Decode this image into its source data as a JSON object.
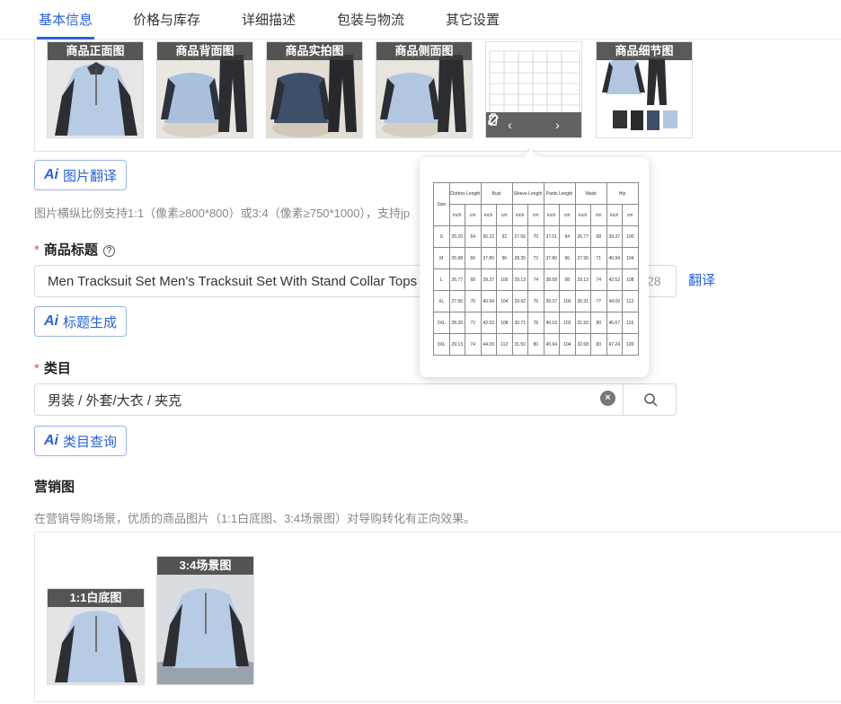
{
  "tabs": [
    "基本信息",
    "价格与库存",
    "详细描述",
    "包装与物流",
    "其它设置"
  ],
  "images": [
    {
      "label": "商品正面图",
      "style": "front"
    },
    {
      "label": "商品背面图",
      "style": "back"
    },
    {
      "label": "商品实拍图",
      "style": "real"
    },
    {
      "label": "商品侧面图",
      "style": "side"
    },
    {
      "label": "",
      "style": "chart"
    },
    {
      "label": "商品细节图",
      "style": "detail"
    }
  ],
  "image_controls": {
    "prev": "‹",
    "next": "›",
    "edit_icon": "pencil-icon",
    "delete_icon": "trash-icon"
  },
  "image_translate_btn": "图片翻译",
  "image_hint": "图片横纵比例支持1:1（像素≥800*800）或3:4（像素≥750*1000），支持jp",
  "title_label": "商品标题",
  "title_help": "?",
  "title_value": "Men Tracksuit Set Men's Tracksuit Set With Stand Collar Tops",
  "title_count": "28",
  "translate_link": "翻译",
  "title_gen_btn": "标题生成",
  "category_label": "类目",
  "category_value": "男装 / 外套/大衣 / 夹克",
  "category_query_btn": "类目查询",
  "marketing_label": "营销图",
  "marketing_hint": "在营销导购场景，优质的商品图片（1:1白底图、3:4场景图）对导购转化有正向效果。",
  "marketing_images": [
    {
      "label": "1:1白底图"
    },
    {
      "label": "3:4场景图"
    }
  ],
  "colors": {
    "accent": "#2962d9",
    "required": "#e34d3b"
  },
  "size_table": {
    "headers": [
      "Size",
      "Clothes Length",
      "Bust",
      "Sleeve Length",
      "Pants Length",
      "Waist",
      "Hip"
    ],
    "units": [
      "inch",
      "cm"
    ],
    "rows": [
      [
        "S",
        "25.20",
        "64",
        "36.22",
        "92",
        "27.56",
        "70",
        "37.01",
        "94",
        "26.77",
        "68",
        "39.37",
        "100"
      ],
      [
        "M",
        "25.98",
        "66",
        "37.80",
        "96",
        "28.35",
        "72",
        "37.80",
        "96",
        "27.95",
        "71",
        "40.94",
        "104"
      ],
      [
        "L",
        "26.77",
        "68",
        "39.37",
        "100",
        "29.13",
        "74",
        "38.58",
        "98",
        "29.13",
        "74",
        "42.52",
        "108"
      ],
      [
        "XL",
        "27.56",
        "70",
        "40.94",
        "104",
        "29.92",
        "76",
        "39.37",
        "100",
        "30.31",
        "77",
        "44.09",
        "112"
      ],
      [
        "2XL",
        "28.35",
        "72",
        "42.52",
        "108",
        "30.71",
        "78",
        "40.16",
        "102",
        "31.50",
        "80",
        "45.67",
        "116"
      ],
      [
        "3XL",
        "29.13",
        "74",
        "44.09",
        "112",
        "31.50",
        "80",
        "40.94",
        "104",
        "32.68",
        "83",
        "47.24",
        "120"
      ]
    ]
  }
}
